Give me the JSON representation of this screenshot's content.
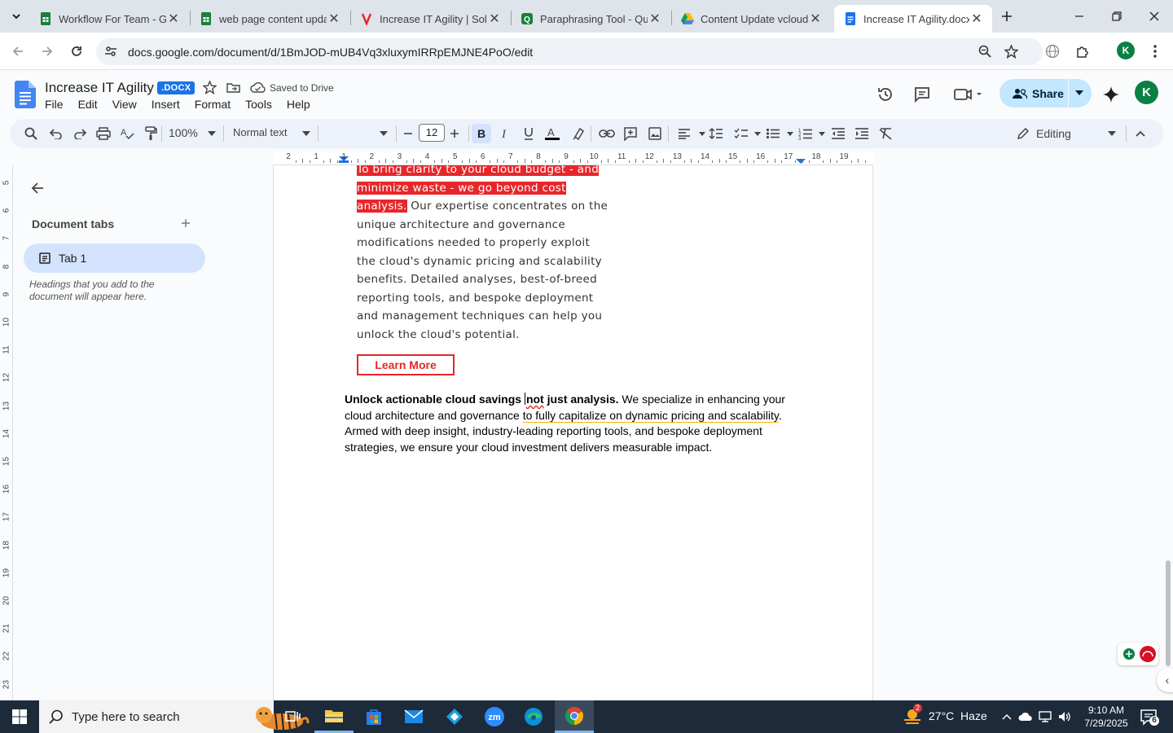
{
  "browser": {
    "tabs": [
      {
        "title": "Workflow For Team - Go",
        "icon": "google-sheets-icon",
        "color": "#188038"
      },
      {
        "title": "web page content upda",
        "icon": "google-sheets-icon",
        "color": "#188038"
      },
      {
        "title": "Increase IT Agility | Solu",
        "icon": "site-favicon-icon",
        "color": "#e8262a"
      },
      {
        "title": "Paraphrasing Tool - Quil",
        "icon": "quillbot-icon",
        "color": "#188038"
      },
      {
        "title": "Content Update vcloud",
        "icon": "google-drive-icon",
        "color": "#fbbc04"
      },
      {
        "title": "Increase IT Agility.docx",
        "icon": "google-docs-icon",
        "color": "#1a73e8"
      }
    ],
    "url": "docs.google.com/document/d/1BmJOD-mUB4Vq3xluxymIRRpEMJNE4PoO/edit",
    "profile_initial": "K"
  },
  "doc": {
    "title": "Increase IT Agility",
    "badge": ".DOCX",
    "save_status": "Saved to Drive",
    "menu": [
      "File",
      "Edit",
      "View",
      "Insert",
      "Format",
      "Tools",
      "Help"
    ],
    "share_label": "Share",
    "avatar_initial": "K"
  },
  "toolbar": {
    "zoom": "100%",
    "style": "Normal text",
    "font": "",
    "font_size": "12",
    "mode": "Editing"
  },
  "ruler": {
    "numbers": [
      "2",
      "1",
      "1",
      "2",
      "3",
      "4",
      "5",
      "6",
      "7",
      "8",
      "9",
      "10",
      "11",
      "12",
      "13",
      "14",
      "15",
      "16",
      "17",
      "18",
      "19"
    ],
    "vertical": [
      "5",
      "6",
      "7",
      "8",
      "9",
      "10",
      "11",
      "12",
      "13",
      "14",
      "15",
      "16",
      "17",
      "18",
      "19",
      "20",
      "21",
      "22",
      "23"
    ]
  },
  "sidebar": {
    "title": "Document tabs",
    "tab_label": "Tab 1",
    "hint": "Headings that you add to the document will appear here."
  },
  "content": {
    "highlighted": "To bring clarity to your cloud budget - and minimize waste - we go beyond cost analysis.",
    "image_text": " Our expertise concentrates on the unique architecture and governance modifications needed to properly exploit the cloud's dynamic pricing and scalability benefits. Detailed analyses, best-of-breed reporting tools, and bespoke deployment and management techniques can help you unlock the cloud's potential.",
    "button": "Learn More",
    "para_bold_1": "Unlock actionable cloud savings ",
    "para_bold_spell": "not",
    "para_bold_2": " just analysis.",
    "para_text_1": " We specialize in enhancing your cloud architecture and governance ",
    "para_text_gram": "to fully capitalize on dynamic pricing and scalability",
    "para_text_2": ". Armed with deep insight, industry-leading reporting tools, and bespoke deployment strategies, we ensure your cloud investment delivers measurable impact."
  },
  "taskbar": {
    "search_placeholder": "Type here to search",
    "weather": "27°C  Haze",
    "weather_badge": "2",
    "time": "9:10 AM",
    "date": "7/29/2025",
    "notification_count": "6"
  }
}
